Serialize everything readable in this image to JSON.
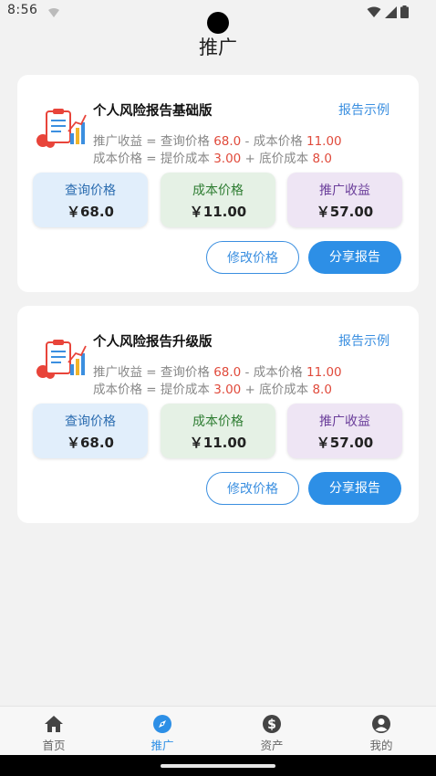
{
  "status": {
    "time": "8:56"
  },
  "header": {
    "title": "推广"
  },
  "cards": [
    {
      "title": "个人风险报告基础版",
      "example_link": "报告示例",
      "formula1": {
        "prefix": "推广收益 = 查询价格 ",
        "query_price": "68.0",
        "mid": " - 成本价格 ",
        "cost_price": "11.00"
      },
      "formula2": {
        "prefix": "成本价格 = 提价成本 ",
        "markup_cost": "3.00",
        "mid": " + 底价成本 ",
        "base_cost": "8.0"
      },
      "stats": {
        "query_label": "查询价格",
        "query_value": "￥68.0",
        "cost_label": "成本价格",
        "cost_value": "￥11.00",
        "profit_label": "推广收益",
        "profit_value": "￥57.00"
      },
      "edit_button": "修改价格",
      "share_button": "分享报告"
    },
    {
      "title": "个人风险报告升级版",
      "example_link": "报告示例",
      "formula1": {
        "prefix": "推广收益 = 查询价格 ",
        "query_price": "68.0",
        "mid": " - 成本价格 ",
        "cost_price": "11.00"
      },
      "formula2": {
        "prefix": "成本价格 = 提价成本 ",
        "markup_cost": "3.00",
        "mid": " + 底价成本 ",
        "base_cost": "8.0"
      },
      "stats": {
        "query_label": "查询价格",
        "query_value": "￥68.0",
        "cost_label": "成本价格",
        "cost_value": "￥11.00",
        "profit_label": "推广收益",
        "profit_value": "￥57.00"
      },
      "edit_button": "修改价格",
      "share_button": "分享报告"
    }
  ],
  "nav": {
    "items": [
      {
        "label": "首页",
        "icon": "home-icon"
      },
      {
        "label": "推广",
        "icon": "compass-icon"
      },
      {
        "label": "资产",
        "icon": "dollar-icon"
      },
      {
        "label": "我的",
        "icon": "user-icon"
      }
    ],
    "active_index": 1
  },
  "colors": {
    "accent": "#2d8fe6",
    "highlight_number": "#e04a3b"
  }
}
